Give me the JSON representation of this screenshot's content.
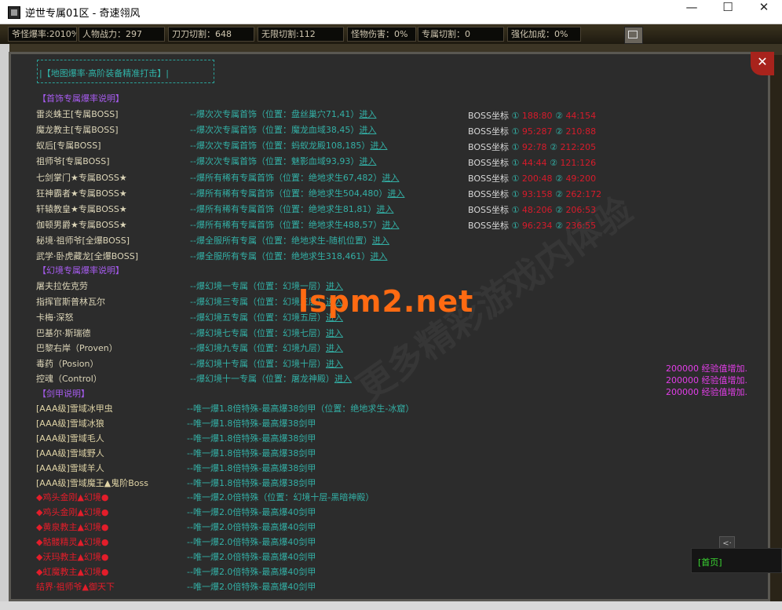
{
  "window": {
    "title": "逆世专属01区 - 奇速翎风",
    "min": "—",
    "max": "☐",
    "close": "✕"
  },
  "stats": [
    {
      "label": "爷怪爆率:2010%"
    },
    {
      "label": "人物战力：297"
    },
    {
      "label": "刀刀切割：648"
    },
    {
      "label": "无限切割:112"
    },
    {
      "label": "怪物伤害：0%"
    },
    {
      "label": "专属切割：0"
    },
    {
      "label": "强化加成：0%"
    }
  ],
  "panel": {
    "close": "✕",
    "header": "|【地图爆率·高阶装备精准打击】|"
  },
  "categories": {
    "c1": "【首饰专属爆率说明】",
    "c2": "【幻境专属爆率说明】",
    "c3": "【剑甲说明】"
  },
  "enter": "进入",
  "rows": [
    {
      "name": "雷炎蛛王[专属BOSS]",
      "desc": "--爆次次专属首饰（位置：盘丝巢穴71,41）"
    },
    {
      "name": "魔龙教主[专属BOSS]",
      "desc": "--爆次次专属首饰（位置：魔龙血域38,45）"
    },
    {
      "name": "蚁后[专属BOSS]",
      "desc": "--爆次次专属首饰（位置：蚂蚁龙殿108,185）"
    },
    {
      "name": "祖师爷[专属BOSS]",
      "desc": "--爆次次专属首饰（位置：魅影血域93,93）"
    },
    {
      "name": "七剑掌门★专属BOSS★",
      "desc": "--爆所有稀有专属首饰（位置：绝地求生67,482）"
    },
    {
      "name": "狂神霸者★专属BOSS★",
      "desc": "--爆所有稀有专属首饰（位置：绝地求生504,480）"
    },
    {
      "name": "轩辕教皇★专属BOSS★",
      "desc": "--爆所有稀有专属首饰（位置：绝地求生81,81）"
    },
    {
      "name": "伽顿男爵★专属BOSS★",
      "desc": "--爆所有稀有专属首饰（位置：绝地求生488,57）"
    },
    {
      "name": "秘境·祖师爷[全爆BOSS]",
      "desc": "--爆全服所有专属（位置：绝地求生-随机位置）"
    },
    {
      "name": "武学·卧虎藏龙[全爆BOSS]",
      "desc": "--爆全服所有专属（位置：绝地求生318,461）"
    },
    {
      "name": "屠夫拉佐克劳",
      "desc": "--爆幻境一专属（位置：幻境一层）"
    },
    {
      "name": "指挥官斯普林瓦尔",
      "desc": "--爆幻境三专属（位置：幻境三层）"
    },
    {
      "name": "卡梅·深怒",
      "desc": "--爆幻境五专属（位置：幻境五层）"
    },
    {
      "name": "巴基尔·斯瑞德",
      "desc": "--爆幻境七专属（位置：幻境七层）"
    },
    {
      "name": "巴黎右岸（Proven）",
      "desc": "--爆幻境九专属（位置：幻境九层）"
    },
    {
      "name": "毒药（Posion）",
      "desc": "--爆幻境十专属（位置：幻境十层）"
    },
    {
      "name": "控魂（Control）",
      "desc": "--爆幻境十一专属（位置：屠龙神殿）"
    }
  ],
  "sword_rows": [
    {
      "name": "[AAA级]雪域冰甲虫",
      "desc": "--唯一爆1.8倍特殊-最高爆38剑甲（位置：绝地求生-冰窟）"
    },
    {
      "name": "[AAA级]雪域冰狼",
      "desc": "--唯一爆1.8倍特殊-最高爆38剑甲"
    },
    {
      "name": "[AAA级]雪域毛人",
      "desc": "--唯一爆1.8倍特殊-最高爆38剑甲"
    },
    {
      "name": "[AAA级]雪域野人",
      "desc": "--唯一爆1.8倍特殊-最高爆38剑甲"
    },
    {
      "name": "[AAA级]雪域羊人",
      "desc": "--唯一爆1.8倍特殊-最高爆38剑甲"
    },
    {
      "name": "[AAA级]雪域魔王▲鬼阶Boss",
      "desc": "--唯一爆1.8倍特殊-最高爆38剑甲"
    }
  ],
  "special_rows": [
    {
      "name": "◆鸡头金刚▲幻境●",
      "desc": "--唯一爆2.0倍特殊（位置：幻境十层-黑暗神殿）"
    },
    {
      "name": "◆鸡头金刚▲幻境●",
      "desc": "--唯一爆2.0倍特殊-最高爆40剑甲"
    },
    {
      "name": "◆黄泉教主▲幻境●",
      "desc": "--唯一爆2.0倍特殊-最高爆40剑甲"
    },
    {
      "name": "◆骷髅精灵▲幻境●",
      "desc": "--唯一爆2.0倍特殊-最高爆40剑甲"
    },
    {
      "name": "◆沃玛教主▲幻境●",
      "desc": "--唯一爆2.0倍特殊-最高爆40剑甲"
    },
    {
      "name": "◆虹魔教主▲幻境●",
      "desc": "--唯一爆2.0倍特殊-最高爆40剑甲"
    },
    {
      "name": "结界·祖师爷▲御天下",
      "desc": "--唯一爆2.0倍特殊-最高爆40剑甲"
    }
  ],
  "boss_coords": {
    "label": "BOSS坐标",
    "n1": "①",
    "n2": "②",
    "rows": [
      {
        "c1": "188:80",
        "c2": "44:154"
      },
      {
        "c1": "95:287",
        "c2": "210:88"
      },
      {
        "c1": "92:78",
        "c2": "212:205"
      },
      {
        "c1": "44:44",
        "c2": "121:126"
      },
      {
        "c1": "200:48",
        "c2": "49:200"
      },
      {
        "c1": "93:158",
        "c2": "262:172"
      },
      {
        "c1": "48:206",
        "c2": "206:53"
      },
      {
        "c1": "96:234",
        "c2": "236:55"
      }
    ]
  },
  "exp_messages": [
    "200000 经验值增加.",
    "200000 经验值增加.",
    "200000 经验值增加."
  ],
  "watermark": "lspm2.net",
  "watermark2": "更多精彩游戏内体验",
  "home_label": "[首页]",
  "scroll_glyph": "<·"
}
